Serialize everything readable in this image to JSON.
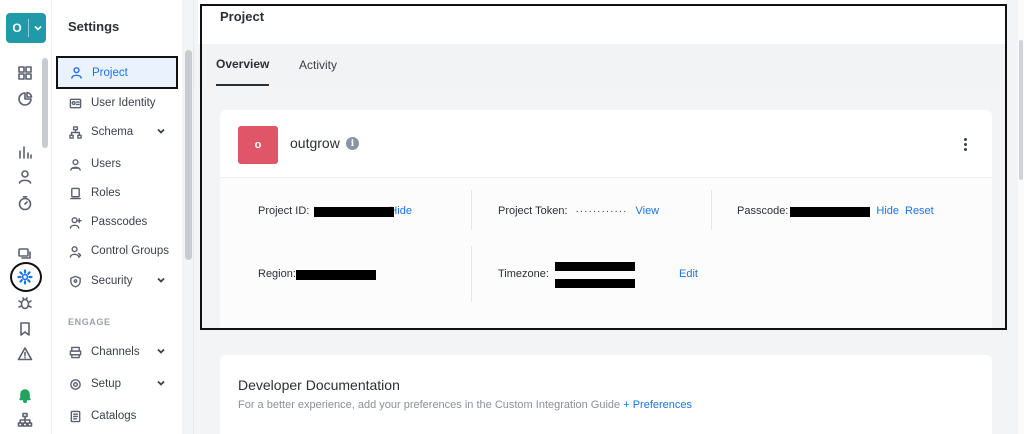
{
  "workspace": {
    "letter": "O"
  },
  "nav": {
    "title": "Settings",
    "items": [
      {
        "label": "Project"
      },
      {
        "label": "User Identity"
      },
      {
        "label": "Schema"
      },
      {
        "label": "Users"
      },
      {
        "label": "Roles"
      },
      {
        "label": "Passcodes"
      },
      {
        "label": "Control Groups"
      },
      {
        "label": "Security"
      }
    ],
    "section_label": "ENGAGE",
    "engage_items": [
      {
        "label": "Channels"
      },
      {
        "label": "Setup"
      },
      {
        "label": "Catalogs"
      }
    ]
  },
  "header": {
    "title": "Project"
  },
  "tabs": [
    {
      "label": "Overview"
    },
    {
      "label": "Activity"
    }
  ],
  "project": {
    "avatar_letter": "o",
    "name": "outgrow",
    "id_label": "Project ID:",
    "id_hide": "Hide",
    "token_label": "Project Token:",
    "token_mask": "············",
    "token_view": "View",
    "passcode_label": "Passcode:",
    "passcode_hide": "Hide",
    "passcode_reset": "Reset",
    "region_label": "Region:",
    "timezone_label": "Timezone:",
    "timezone_edit": "Edit"
  },
  "docs": {
    "title": "Developer Documentation",
    "subtitle": "For a better experience, add your preferences in the Custom Integration Guide",
    "link": "+ Preferences"
  },
  "colors": {
    "accent": "#1a73e8",
    "workspace": "#1f9aa8",
    "project_avatar": "#e05568",
    "alert_bell": "#21a35c"
  }
}
